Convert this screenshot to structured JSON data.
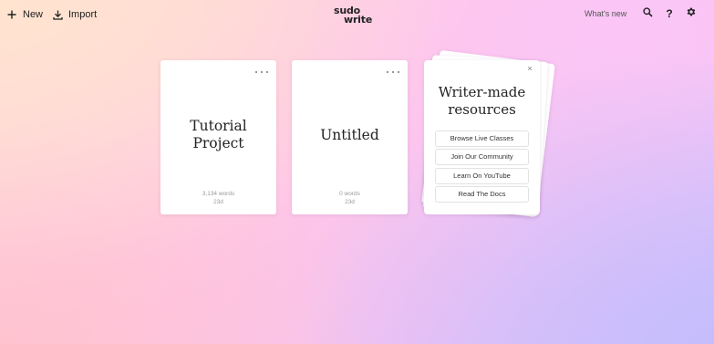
{
  "topbar": {
    "new_label": "New",
    "import_label": "Import",
    "logo_line1": "sudo",
    "logo_line2": "write",
    "whats_new_label": "What's new",
    "help_label": "?"
  },
  "projects": [
    {
      "title": "Tutorial\nProject",
      "words": "3,134 words",
      "age": "23d"
    },
    {
      "title": "Untitled",
      "words": "0 words",
      "age": "23d"
    }
  ],
  "resources": {
    "title": "Writer-made\nresources",
    "close_label": "×",
    "buttons": [
      "Browse Live Classes",
      "Join Our Community",
      "Learn On YouTube",
      "Read The Docs"
    ]
  },
  "icons": {
    "new": "plus-icon",
    "import": "download-icon",
    "search": "search-icon",
    "help": "help-icon",
    "settings": "gear-icon",
    "more": "more-icon",
    "close": "close-icon"
  }
}
